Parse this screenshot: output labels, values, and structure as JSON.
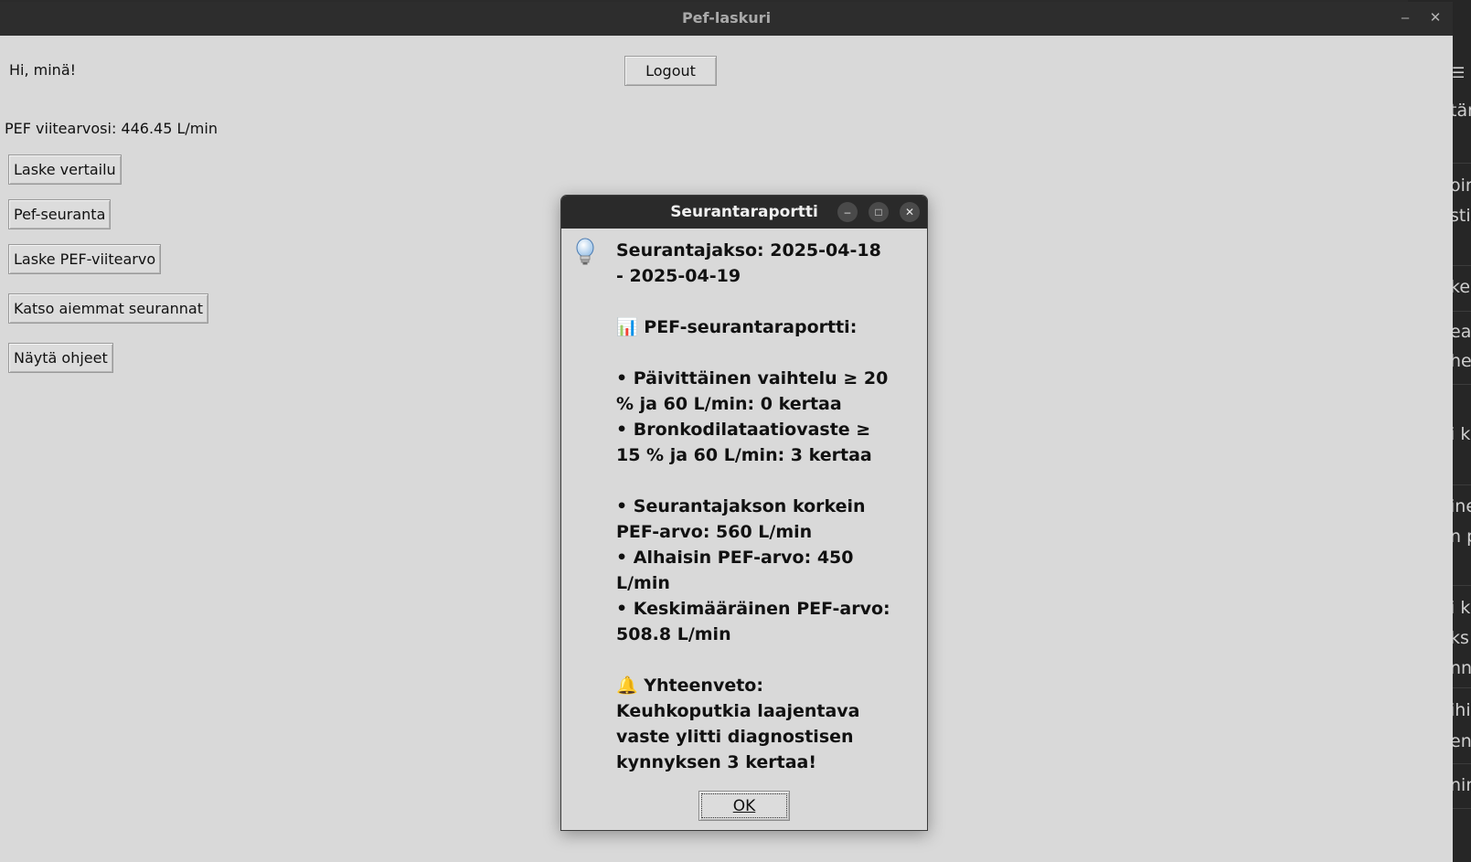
{
  "background_window": {
    "menu_icon": "hamburger-icon",
    "text_fragments": [
      "tär",
      "oir",
      "sti",
      "ker",
      "ea",
      "he",
      "i k",
      "ine",
      "n p",
      "i k",
      "ks",
      "nn",
      "ihi",
      "en",
      "nin"
    ]
  },
  "window": {
    "title": "Pef-laskuri",
    "minimize_symbol": "–",
    "close_symbol": "✕"
  },
  "main": {
    "greeting": "Hi, minä!",
    "logout_label": "Logout",
    "pef_reference": "PEF viitearvosi: 446.45 L/min",
    "buttons": [
      "Laske vertailu",
      "Pef-seuranta",
      "Laske PEF-viitearvo",
      "Katso aiemmat seurannat",
      "Näytä ohjeet"
    ]
  },
  "dialog": {
    "title": "Seurantaraportti",
    "icon": "lightbulb-icon",
    "minimize_symbol": "–",
    "maximize_symbol": "□",
    "close_symbol": "✕",
    "lines": {
      "period": "Seurantajakso: 2025-04-18 - 2025-04-19",
      "report_heading": "📊 PEF-seurantaraportti:",
      "daily_variation": "• Päivittäinen vaihtelu ≥ 20 % ja 60 L/min: 0 kertaa",
      "bronchodilation": "• Bronkodilataatiovaste ≥ 15 % ja 60 L/min: 3 kertaa",
      "highest": "• Seurantajakson korkein PEF-arvo: 560 L/min",
      "lowest": "• Alhaisin PEF-arvo: 450 L/min",
      "average": "• Keskimääräinen PEF-arvo: 508.8 L/min",
      "summary": "🔔 Yhteenveto: Keuhkoputkia laajentava vaste ylitti diagnostisen kynnyksen 3 kertaa!"
    },
    "ok_label": "OK"
  }
}
